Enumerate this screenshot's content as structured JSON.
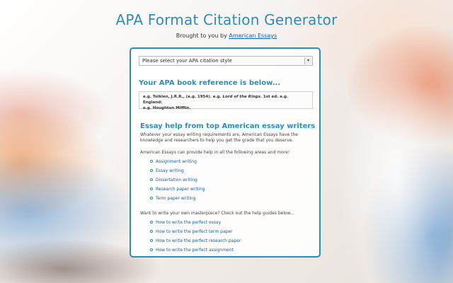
{
  "header": {
    "title": "APA Format Citation Generator",
    "subtitle_prefix": "Brought to you by ",
    "subtitle_link": "American Essays"
  },
  "panel": {
    "select_value": "Please select your APA citation style",
    "reference_heading": "Your APA book reference is below...",
    "reference_line1_a": "e.g. Tolkien, J.R.R., (e.g. 1954). e.g. ",
    "reference_line1_italic": "Lord of the Rings",
    "reference_line1_b": ". 1st ed. e.g. England:",
    "reference_line2": "e.g. Houghton Mifflin.",
    "help_heading": "Essay help from top American essay writers",
    "help_text": "Whatever your essay writing requirements are, American Essays have the knowledge and researchers to help you get the grade that you deserve.",
    "areas_intro": "American Essays can provide help in all the following areas and more!",
    "areas": [
      "Assignment writing",
      "Essay writing",
      "Dissertation writing",
      "Research paper writing",
      "Term paper writing"
    ],
    "guides_intro": "Want to write your own masterpiece? Check out the help guides below...",
    "guides": [
      "How to write the perfect essay",
      "How to write the perfect term paper",
      "How to write the perfect research paper",
      "How to write the perfect assignment"
    ]
  },
  "colors": {
    "accent": "#2f8db5",
    "link": "#1a5f9e"
  }
}
